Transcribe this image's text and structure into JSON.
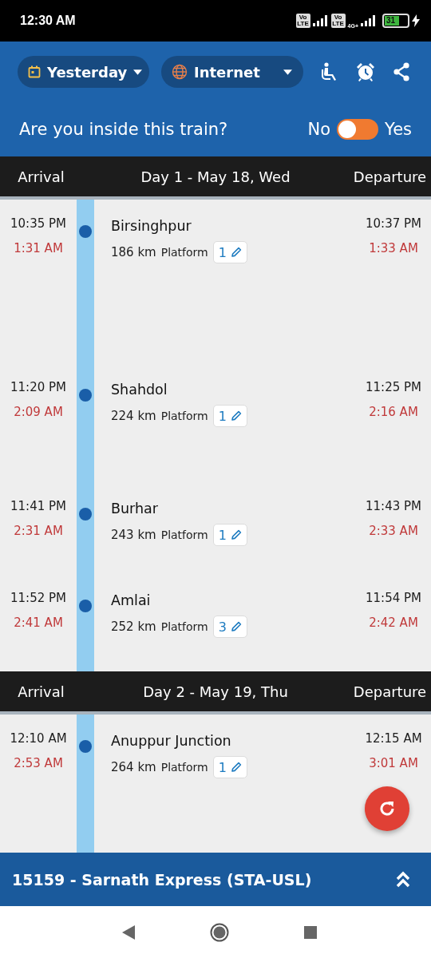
{
  "status_bar": {
    "time": "12:30 AM",
    "sim_badges": [
      "Vo LTE",
      "Vo LTE"
    ],
    "network_label": "4G+",
    "battery": "31"
  },
  "header": {
    "date_picker": {
      "label": "Yesterday"
    },
    "source_picker": {
      "label": "Internet"
    },
    "question": "Are you inside this train?",
    "toggle": {
      "off_label": "No",
      "on_label": "Yes",
      "on": false
    }
  },
  "days": [
    {
      "arrival_heading": "Arrival",
      "title": "Day 1 - May 18, Wed",
      "departure_heading": "Departure",
      "stops": [
        {
          "name": "Birsinghpur",
          "distance": "186 km",
          "platform_label": "Platform",
          "platform": "1",
          "arrival": "10:35 PM",
          "arrival_actual": "1:31 AM",
          "departure": "10:37 PM",
          "departure_actual": "1:33 AM"
        },
        {
          "name": "Shahdol",
          "distance": "224 km",
          "platform_label": "Platform",
          "platform": "1",
          "arrival": "11:20 PM",
          "arrival_actual": "2:09 AM",
          "departure": "11:25 PM",
          "departure_actual": "2:16 AM"
        },
        {
          "name": "Burhar",
          "distance": "243 km",
          "platform_label": "Platform",
          "platform": "1",
          "arrival": "11:41 PM",
          "arrival_actual": "2:31 AM",
          "departure": "11:43 PM",
          "departure_actual": "2:33 AM"
        },
        {
          "name": "Amlai",
          "distance": "252 km",
          "platform_label": "Platform",
          "platform": "3",
          "arrival": "11:52 PM",
          "arrival_actual": "2:41 AM",
          "departure": "11:54 PM",
          "departure_actual": "2:42 AM"
        }
      ]
    },
    {
      "arrival_heading": "Arrival",
      "title": "Day 2 - May 19, Thu",
      "departure_heading": "Departure",
      "stops": [
        {
          "name": "Anuppur Junction",
          "distance": "264 km",
          "platform_label": "Platform",
          "platform": "1",
          "arrival": "12:10 AM",
          "arrival_actual": "2:53 AM",
          "departure": "12:15 AM",
          "departure_actual": "3:01 AM"
        }
      ]
    }
  ],
  "train_bar": {
    "title": "15159 - Sarnath Express (STA-USL)"
  }
}
